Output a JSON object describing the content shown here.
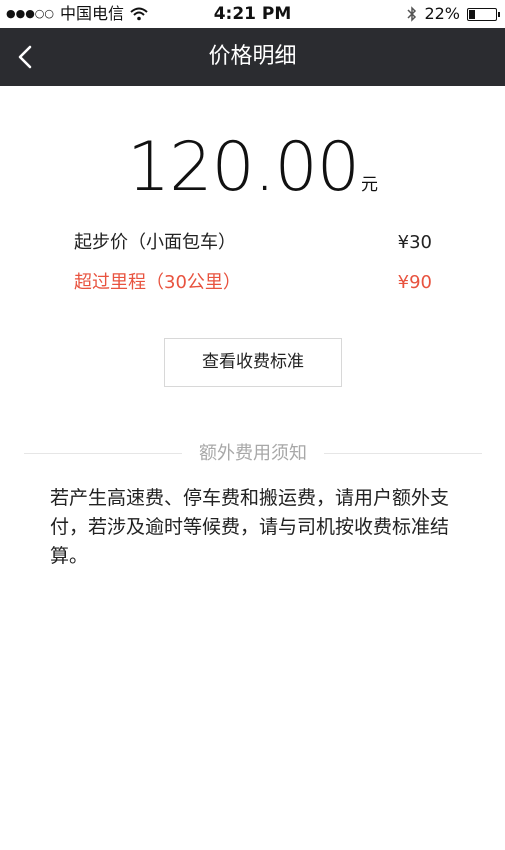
{
  "status_bar": {
    "carrier": "中国电信",
    "time": "4:21 PM",
    "battery_text": "22%",
    "battery_level": 0.22
  },
  "nav": {
    "title": "价格明细"
  },
  "price": {
    "amount": "120.00",
    "unit": "元"
  },
  "fees": [
    {
      "label": "起步价（小面包车）",
      "value": "¥30"
    },
    {
      "label": "超过里程（30公里）",
      "value": "¥90",
      "color": "#e8533f"
    }
  ],
  "actions": {
    "view_standard": "查看收费标准"
  },
  "notice": {
    "heading": "额外费用须知",
    "body": "若产生高速费、停车费和搬运费，请用户额外支付，若涉及逾时等候费，请与司机按收费标准结算。"
  }
}
